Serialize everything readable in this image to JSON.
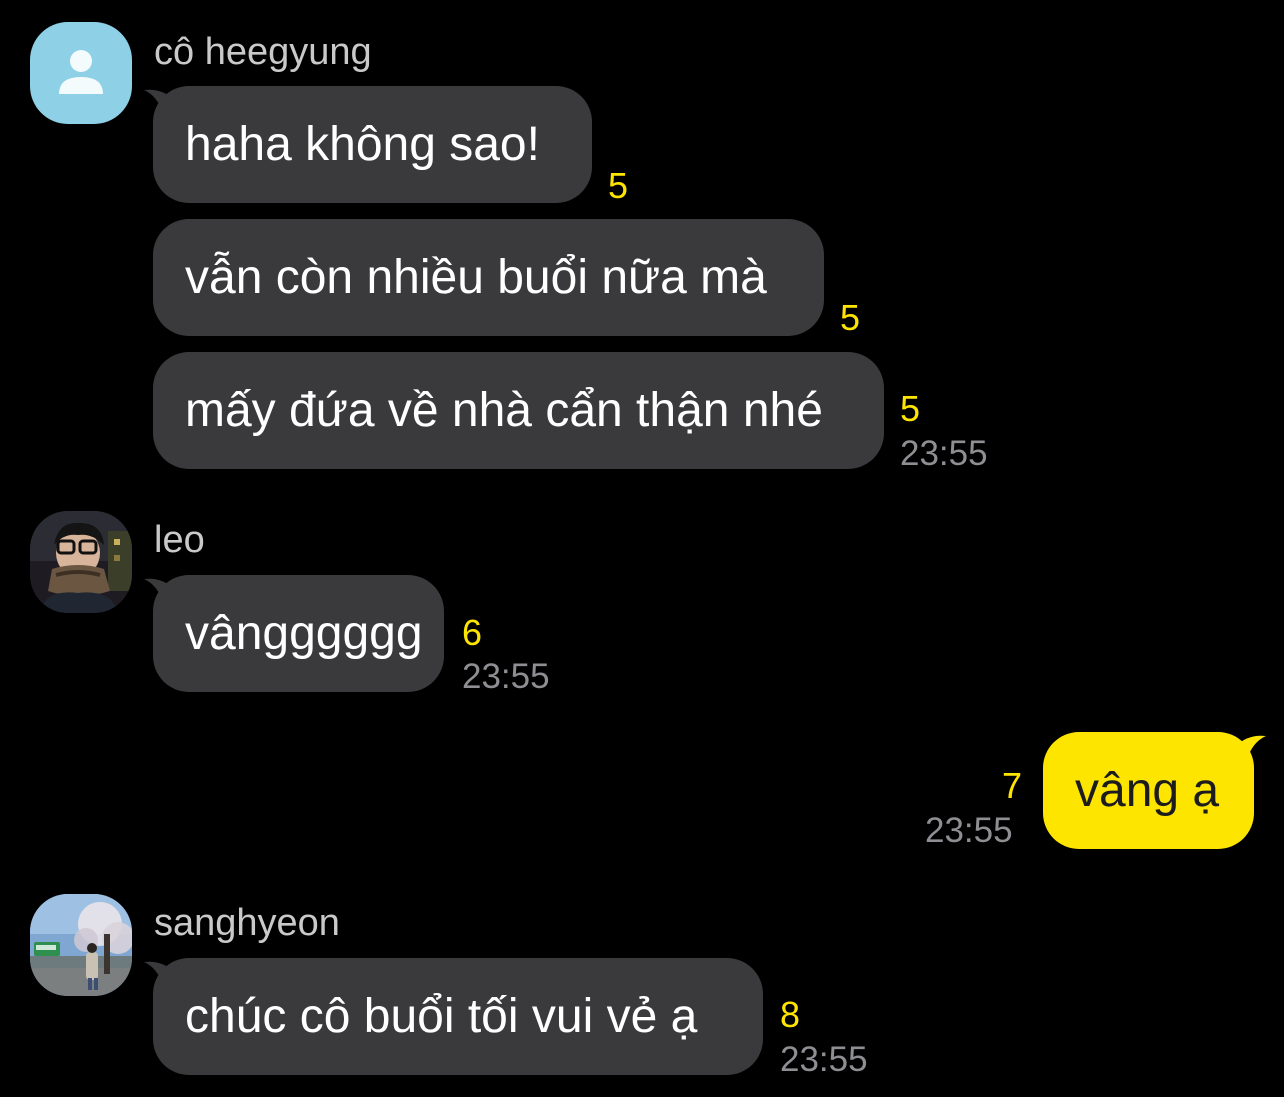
{
  "groups": [
    {
      "sender": "cô heegyung",
      "avatar_icon": "default-person-icon",
      "messages": [
        {
          "text": "haha không sao!",
          "unread": "5"
        },
        {
          "text": "vẫn còn nhiều buổi nữa mà",
          "unread": "5"
        },
        {
          "text": "mấy đứa về nhà cẩn thận nhé",
          "unread": "5",
          "time": "23:55"
        }
      ]
    },
    {
      "sender": "leo",
      "avatar_icon": "profile-photo",
      "messages": [
        {
          "text": "vângggggg",
          "unread": "6",
          "time": "23:55"
        }
      ]
    },
    {
      "sender": "",
      "mine": true,
      "messages": [
        {
          "text": "vâng ạ",
          "unread": "7",
          "time": "23:55"
        }
      ]
    },
    {
      "sender": "sanghyeon",
      "avatar_icon": "profile-photo",
      "messages": [
        {
          "text": "chúc cô buổi tối vui vẻ ạ",
          "unread": "8",
          "time": "23:55"
        }
      ]
    }
  ],
  "colors": {
    "background": "#000000",
    "incoming_bubble": "#3a3a3c",
    "outgoing_bubble": "#fee500",
    "unread_count": "#fee500",
    "timestamp": "#8e8e93",
    "default_avatar": "#8ed1e6"
  }
}
